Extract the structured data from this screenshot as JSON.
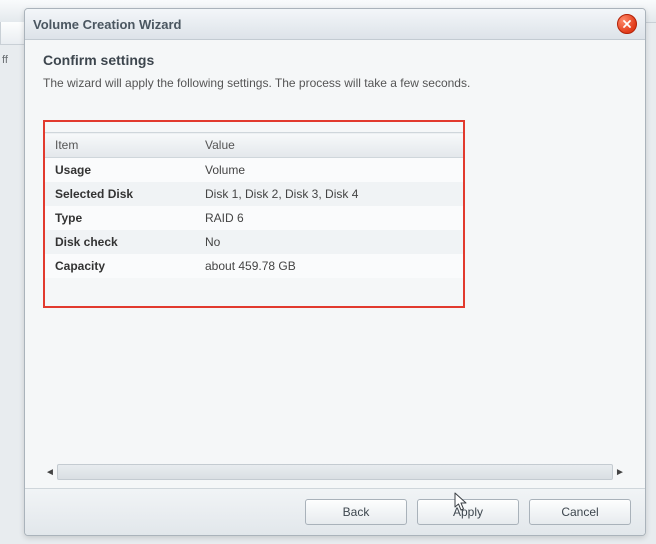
{
  "bg": {
    "off_label": "ff"
  },
  "dialog": {
    "title": "Volume Creation Wizard",
    "step_title": "Confirm settings",
    "step_desc": "The wizard will apply the following settings. The process will take a few seconds.",
    "table": {
      "headers": {
        "item": "Item",
        "value": "Value"
      },
      "rows": [
        {
          "key": "Usage",
          "value": "Volume"
        },
        {
          "key": "Selected Disk",
          "value": "Disk 1, Disk 2, Disk 3, Disk 4"
        },
        {
          "key": "Type",
          "value": "RAID 6"
        },
        {
          "key": "Disk check",
          "value": "No"
        },
        {
          "key": "Capacity",
          "value": "about 459.78 GB"
        }
      ]
    },
    "buttons": {
      "back": "Back",
      "apply": "Apply",
      "cancel": "Cancel"
    }
  }
}
